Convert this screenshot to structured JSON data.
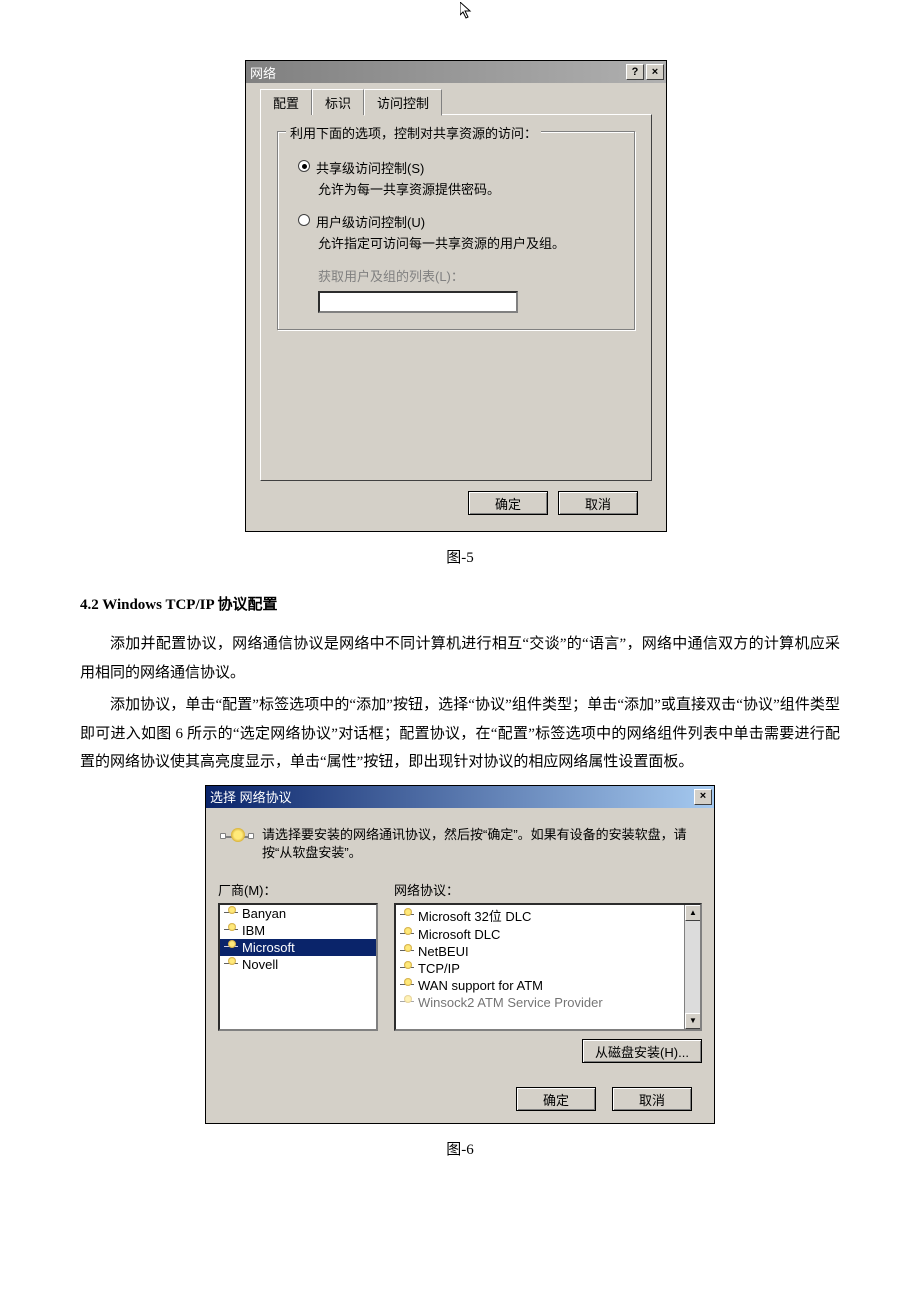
{
  "dialog1": {
    "title": "网络",
    "help_btn": "?",
    "close_btn": "×",
    "tabs": {
      "t0": "配置",
      "t1": "标识",
      "t2": "访问控制"
    },
    "group_title": "利用下面的选项，控制对共享资源的访问：",
    "opt1_label": "共享级访问控制(S)",
    "opt1_desc": "允许为每一共享资源提供密码。",
    "opt2_label": "用户级访问控制(U)",
    "opt2_desc": "允许指定可访问每一共享资源的用户及组。",
    "list_label": "获取用户及组的列表(L)：",
    "ok": "确定",
    "cancel": "取消"
  },
  "caption1": "图-5",
  "section_heading": "4.2 Windows TCP/IP 协议配置",
  "para1": "添加并配置协议，网络通信协议是网络中不同计算机进行相互“交谈”的“语言”，网络中通信双方的计算机应采用相同的网络通信协议。",
  "para2": "添加协议，单击“配置”标签选项中的“添加”按钮，选择“协议”组件类型；单击“添加”或直接双击“协议”组件类型即可进入如图 6 所示的“选定网络协议”对话框；配置协议，在“配置”标签选项中的网络组件列表中单击需要进行配置的网络协议使其高亮度显示，单击“属性”按钮，即出现针对协议的相应网络属性设置面板。",
  "dialog2": {
    "title": "选择 网络协议",
    "close_btn": "×",
    "instruction": "请选择要安装的网络通讯协议，然后按“确定”。如果有设备的安装软盘，请按“从软盘安装”。",
    "left_header": "厂商(M)：",
    "right_header": "网络协议：",
    "vendors": {
      "v0": "Banyan",
      "v1": "IBM",
      "v2": "Microsoft",
      "v3": "Novell"
    },
    "protocols": {
      "p0": "Microsoft 32位 DLC",
      "p1": "Microsoft DLC",
      "p2": "NetBEUI",
      "p3": "TCP/IP",
      "p4": "WAN support for ATM",
      "p5": "Winsock2 ATM Service Provider"
    },
    "from_disk": "从磁盘安装(H)...",
    "ok": "确定",
    "cancel": "取消"
  },
  "caption2": "图-6"
}
